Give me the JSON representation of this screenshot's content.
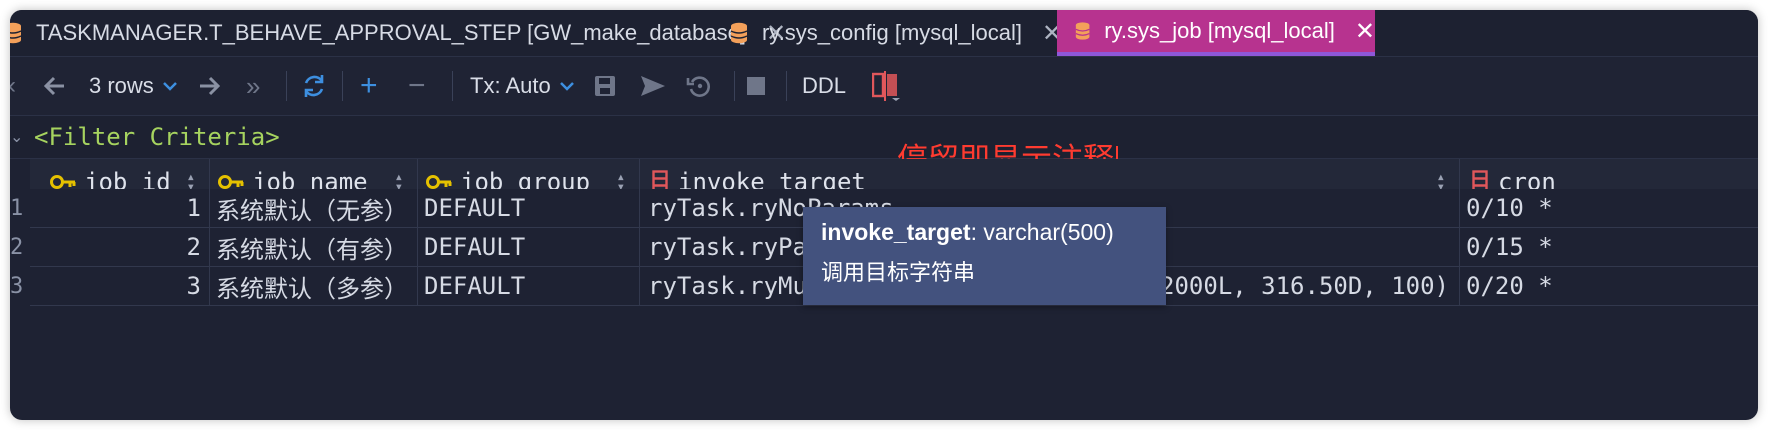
{
  "tabs": [
    {
      "label": "TASKMANAGER.T_BEHAVE_APPROVAL_STEP [GW_make_database]",
      "close": "✕"
    },
    {
      "label": "ry.sys_config [mysql_local]",
      "close": "✕"
    },
    {
      "label": "ry.sys_job [mysql_local]",
      "close": "✕",
      "active": true
    }
  ],
  "toolbar": {
    "rows_label": "3 rows",
    "tx_label": "Tx: Auto",
    "ddl_label": "DDL"
  },
  "filter": {
    "text": "<Filter Criteria>"
  },
  "columns": [
    {
      "name": "job_id",
      "icon": "key-icon"
    },
    {
      "name": "job_name",
      "icon": "key-icon"
    },
    {
      "name": "job_group",
      "icon": "key-icon"
    },
    {
      "name": "invoke_target",
      "icon": "column-icon"
    },
    {
      "name": "cron_",
      "icon": "column-icon"
    }
  ],
  "rows": [
    {
      "num": "1",
      "job_id": "1",
      "job_name": "系统默认（无参）",
      "job_group": "DEFAULT",
      "invoke_target": "ryTask.ryNoParams",
      "cron": "0/10 *"
    },
    {
      "num": "2",
      "job_id": "2",
      "job_name": "系统默认（有参）",
      "job_group": "DEFAULT",
      "invoke_target": "ryTask.ryPa",
      "cron": "0/15 *"
    },
    {
      "num": "3",
      "job_id": "3",
      "job_name": "系统默认（多参）",
      "job_group": "DEFAULT",
      "invoke_target": "ryTask.ryMu",
      "invoke_target_tail": "2000L, 316.50D, 100)",
      "cron": "0/20 *"
    }
  ],
  "annotation": "停留即显示注释",
  "tooltip": {
    "column": "invoke_target",
    "type": ": varchar(500)",
    "comment": "调用目标字符串"
  },
  "colors": {
    "active_tab": "#b7338f",
    "key_icon": "#e5c100",
    "column_icon": "#e0575b",
    "accent_blue": "#3d8fe0",
    "filter_text": "#a6d35f",
    "annotation": "#ff3b30",
    "tooltip_bg": "#43527e"
  }
}
